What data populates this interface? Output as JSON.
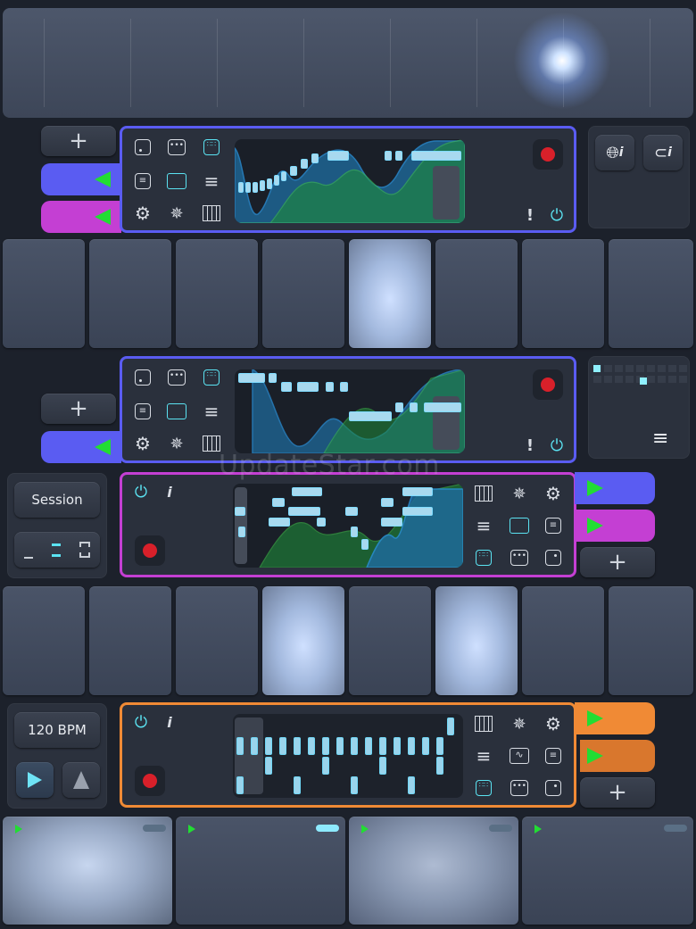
{
  "session_label": "Session",
  "tempo_label": "120 BPM",
  "add_label": "+",
  "watermark": "UpdateStar.com",
  "colors": {
    "blue_accent": "#5a5cf2",
    "purple_accent": "#c43fd3",
    "orange_accent": "#f08a35",
    "play_green": "#22dd33",
    "record_red": "#d8202a",
    "active_cyan": "#5be3f2"
  },
  "instruments": [
    {
      "name": "synth-1",
      "accent": "blue",
      "icons": [
        "single-dot-icon",
        "three-dots-icon",
        "grid-dots-icon",
        "sliders-icon",
        "pattern-blocks-icon",
        "list-lines-icon",
        "gear-icon",
        "shape-morph-icon",
        "piano-keys-icon",
        "exclamation-icon",
        "power-loop-icon"
      ]
    },
    {
      "name": "synth-2",
      "accent": "blue"
    },
    {
      "name": "drum-machine",
      "accent": "purple"
    },
    {
      "name": "step-sequencer",
      "accent": "orange"
    }
  ],
  "pad_rows": [
    {
      "lit": [
        4
      ]
    },
    {
      "lit": [
        3,
        5
      ]
    }
  ],
  "clip_pads": [
    {
      "bar_active": false,
      "lit": true
    },
    {
      "bar_active": true,
      "lit": false
    },
    {
      "bar_active": false,
      "lit": true
    },
    {
      "bar_active": false,
      "lit": false
    }
  ]
}
